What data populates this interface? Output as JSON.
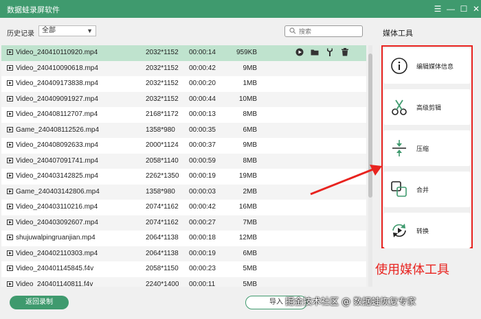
{
  "window": {
    "title": "数据蛙录屏软件",
    "controls": {
      "menu": "☰",
      "minimize": "—",
      "maximize": "☐",
      "close": "✕"
    }
  },
  "history": {
    "label": "历史记录",
    "filter_value": "全部"
  },
  "search": {
    "placeholder": "搜索"
  },
  "files": [
    {
      "name": "Video_240410110920.mp4",
      "resolution": "2032*1152",
      "duration": "00:00:14",
      "size": "959KB",
      "selected": true
    },
    {
      "name": "Video_240410090618.mp4",
      "resolution": "2032*1152",
      "duration": "00:00:42",
      "size": "9MB"
    },
    {
      "name": "Video_240409173838.mp4",
      "resolution": "2032*1152",
      "duration": "00:00:20",
      "size": "1MB"
    },
    {
      "name": "Video_240409091927.mp4",
      "resolution": "2032*1152",
      "duration": "00:00:44",
      "size": "10MB"
    },
    {
      "name": "Video_240408112707.mp4",
      "resolution": "2168*1172",
      "duration": "00:00:13",
      "size": "8MB"
    },
    {
      "name": "Game_240408112526.mp4",
      "resolution": "1358*980",
      "duration": "00:00:35",
      "size": "6MB"
    },
    {
      "name": "Video_240408092633.mp4",
      "resolution": "2000*1124",
      "duration": "00:00:37",
      "size": "9MB"
    },
    {
      "name": "Video_240407091741.mp4",
      "resolution": "2058*1140",
      "duration": "00:00:59",
      "size": "8MB"
    },
    {
      "name": "Video_240403142825.mp4",
      "resolution": "2262*1350",
      "duration": "00:00:19",
      "size": "19MB"
    },
    {
      "name": "Game_240403142806.mp4",
      "resolution": "1358*980",
      "duration": "00:00:03",
      "size": "2MB"
    },
    {
      "name": "Video_240403110216.mp4",
      "resolution": "2074*1162",
      "duration": "00:00:42",
      "size": "16MB"
    },
    {
      "name": "Video_240403092607.mp4",
      "resolution": "2074*1162",
      "duration": "00:00:27",
      "size": "7MB"
    },
    {
      "name": "shujuwalpingruanjian.mp4",
      "resolution": "2064*1138",
      "duration": "00:00:18",
      "size": "12MB"
    },
    {
      "name": "Video_240402110303.mp4",
      "resolution": "2064*1138",
      "duration": "00:00:19",
      "size": "6MB"
    },
    {
      "name": "Video_240401145845.f4v",
      "resolution": "2058*1150",
      "duration": "00:00:23",
      "size": "5MB"
    },
    {
      "name": "Video_240401140811.f4v",
      "resolution": "2240*1400",
      "duration": "00:00:11",
      "size": "5MB"
    }
  ],
  "row_actions": [
    "play-icon",
    "folder-icon",
    "edit-tool-icon",
    "trash-icon"
  ],
  "footer": {
    "back_label": "返回录制",
    "import_label": "导入"
  },
  "watermark": "掘金技术社区 @ 数据蛙恢复专家",
  "media_tools": {
    "title": "媒体工具",
    "items": [
      {
        "label": "编辑媒体信息",
        "icon": "info-icon"
      },
      {
        "label": "高级剪辑",
        "icon": "scissors-icon"
      },
      {
        "label": "压缩",
        "icon": "compress-icon"
      },
      {
        "label": "合并",
        "icon": "merge-icon"
      },
      {
        "label": "转换",
        "icon": "convert-icon"
      }
    ]
  },
  "annotation": {
    "text": "使用媒体工具",
    "color": "#e8231f"
  },
  "colors": {
    "accent": "#3f9a6e",
    "selected_row": "#bfe3ce",
    "annotation": "#e8231f"
  }
}
